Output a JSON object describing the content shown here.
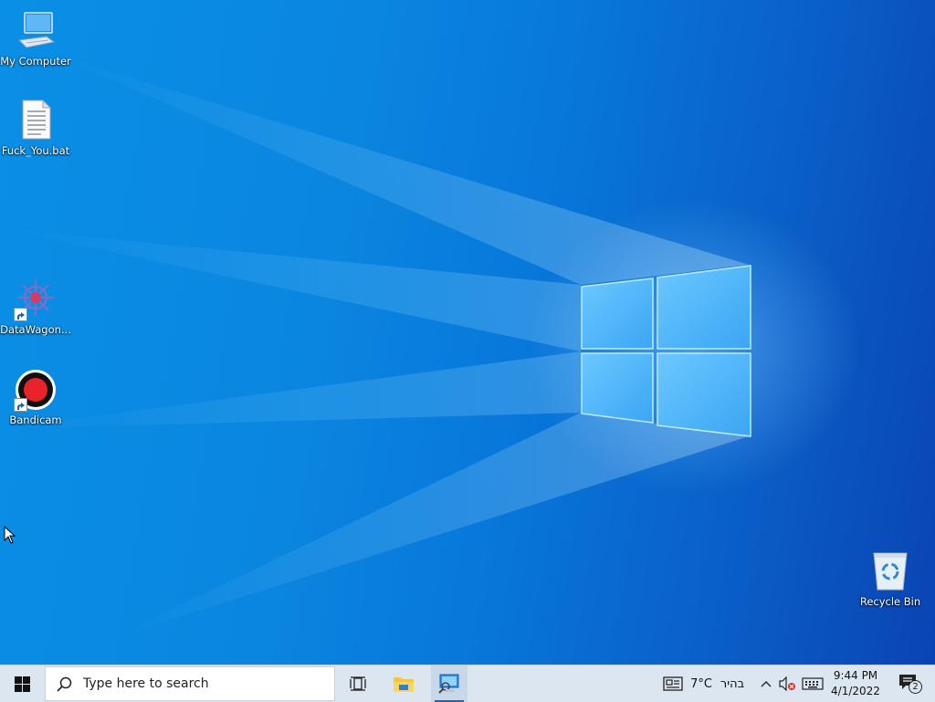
{
  "desktop": {
    "icons": [
      {
        "label": "My Computer",
        "icon": "computer-icon"
      },
      {
        "label": "Fuck_You.bat",
        "icon": "batch-file-icon"
      },
      {
        "label": "DataWagon...",
        "icon": "datawagon-gear-icon"
      },
      {
        "label": "Bandicam",
        "icon": "bandicam-record-icon"
      },
      {
        "label": "Recycle Bin",
        "icon": "recycle-bin-icon"
      }
    ]
  },
  "taskbar": {
    "start_icon": "windows-logo-icon",
    "search_placeholder": "Type here to search",
    "task_view_icon": "task-view-icon",
    "pinned": [
      {
        "icon": "file-explorer-icon"
      },
      {
        "icon": "network-monitor-app-icon",
        "active": true
      }
    ],
    "weather": {
      "temp": "7°C",
      "condition": "בהיר",
      "icon": "news-weather-icon"
    },
    "tray_icons": [
      "chevron-up-icon",
      "volume-muted-icon",
      "keyboard-icon"
    ],
    "clock": {
      "time": "9:44 PM",
      "date": "4/1/2022"
    },
    "notifications": {
      "count": "2",
      "icon": "action-center-icon"
    }
  },
  "colors": {
    "taskbar_bg": "#dce6f0",
    "wallpaper_accent": "#0a78d8",
    "active_indicator": "#0a6ad0"
  }
}
